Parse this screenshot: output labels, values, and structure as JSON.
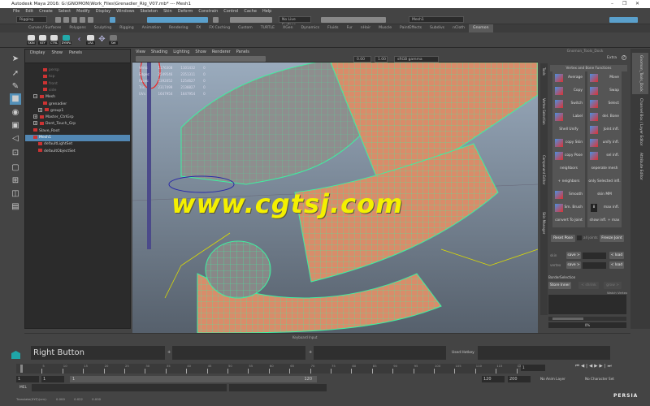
{
  "window": {
    "title": "Autodesk Maya 2016: G:\\GNOMON\\Work_Files\\Grenadier_Rig_V07.mb*  ---  Mesh1",
    "minimize": "–",
    "restore": "❐",
    "close": "✕"
  },
  "menus": [
    "File",
    "Edit",
    "Create",
    "Select",
    "Modify",
    "Display",
    "Windows",
    "Skeleton",
    "Skin",
    "Deform",
    "Constrain",
    "Control",
    "Cache",
    "Help"
  ],
  "status_line": {
    "menu_set": "Rigging",
    "live_surface": "No Live Surface",
    "object_name": "Mesh1"
  },
  "shelf_tabs": [
    "Curves / Surfaces",
    "Polygons",
    "Sculpting",
    "Rigging",
    "Animation",
    "Rendering",
    "FX",
    "FX Caching",
    "Custom",
    "TURTLE",
    "XGen",
    "Dynamics",
    "Fluids",
    "Fur",
    "nHair",
    "Muscle",
    "PaintEffects",
    "Subdivs",
    "nCloth",
    "Gnomon"
  ],
  "active_shelf_tab": "Gnomon",
  "shelf_buttons": [
    "SKIN",
    "KEY",
    "CTRL",
    "DYNPA",
    "",
    "LRA",
    "",
    "Set"
  ],
  "outliner": {
    "menu": [
      "Display",
      "Show",
      "Panels"
    ],
    "items": [
      {
        "label": "persp",
        "dim": true
      },
      {
        "label": "top",
        "dim": true
      },
      {
        "label": "front",
        "dim": true
      },
      {
        "label": "side",
        "dim": true
      },
      {
        "label": "Mesh"
      },
      {
        "label": "grenadier"
      },
      {
        "label": "group1"
      },
      {
        "label": "Master_CtrlGrp"
      },
      {
        "label": "Dont_Touch_Grp"
      },
      {
        "label": "Slave_Root"
      },
      {
        "label": "Mesh1",
        "selected": true
      },
      {
        "label": "defaultLightSet"
      },
      {
        "label": "defaultObjectSet"
      }
    ]
  },
  "viewport": {
    "menu": [
      "View",
      "Shading",
      "Lighting",
      "Show",
      "Renderer",
      "Panels"
    ],
    "exposure": "0.00",
    "gamma": "1.00",
    "color_space": "sRGB gamma",
    "hud": [
      {
        "label": "Verts:",
        "a": "1176308",
        "b": "1101432",
        "c": "0"
      },
      {
        "label": "Edges:",
        "a": "2549546",
        "b": "2351311",
        "c": "0"
      },
      {
        "label": "Faces:",
        "a": "1392052",
        "b": "1254627",
        "c": "0"
      },
      {
        "label": "Tris:",
        "a": "2317499",
        "b": "2138827",
        "c": "0"
      },
      {
        "label": "UVs:",
        "a": "1647954",
        "b": "1647954",
        "c": "0"
      }
    ],
    "watermark": "www.cgtsj.com"
  },
  "dock": {
    "title": "Gnomon_Tools_Dock",
    "extra": "Extra",
    "help": "?",
    "section": "Vertex and Bone Functions",
    "left_tabs": [
      "Tools",
      "Vertex Selection",
      "Component Editor",
      "Skin Manager"
    ],
    "left_buttons": [
      "Average",
      "Copy",
      "Switch",
      "Label",
      "Shell Unify",
      "copy Skin",
      "copy Pose",
      "neighbors",
      "+ neighbors",
      "Smooth",
      "Sm. Brush",
      "convert To Joint"
    ],
    "right_buttons": [
      "Move",
      "Swap",
      "Select",
      "del. Bone",
      "Joint infl.",
      "unify infl.",
      "sel infl.",
      "seperate mesh",
      "only Selected infl.",
      "skin MM",
      "max infl.",
      "show infl. + max"
    ],
    "max_infl_value": "8",
    "reset_pose": "Reset Pose",
    "all_joints": "all joints",
    "freeze_joint": "Freeze Joint",
    "skin_label": "skin",
    "vertex_label": "vertex",
    "save": "save >",
    "load": "< load",
    "border_section": "BorderSelection",
    "store_inner": "Store Inner",
    "shrink": "< shrink",
    "grow": "grow >",
    "watch_vertex": "Watch Vertex",
    "progress": "0%",
    "progress_value": 0
  },
  "side_tabs": [
    "Gnomon_Tools_Dock",
    "Channel Box / Layer Editor",
    "Attribute Editor"
  ],
  "hotkey": {
    "header": "Keyboard Input",
    "input": "Right Button",
    "plus": "+",
    "used_hotkey_label": "Used Hotkey"
  },
  "timeline": {
    "ticks": [
      "5",
      "10",
      "15",
      "20",
      "25",
      "30",
      "35",
      "40",
      "45",
      "50",
      "55",
      "60",
      "65",
      "70",
      "75",
      "80",
      "85",
      "90",
      "95",
      "100",
      "105",
      "110",
      "115",
      "120"
    ],
    "current_frame": "1",
    "start": "1",
    "playback_start": "1",
    "range_start": "1",
    "range_end": "120",
    "playback_end": "120",
    "end": "200",
    "anim_layer": "No Anim Layer",
    "character_set": "No Character Set"
  },
  "command_line": {
    "label": "MEL"
  },
  "help_line": {
    "label": "Translate(XYZ)(cm):",
    "x": "0.000",
    "y": "0.022",
    "z": "0.000"
  },
  "corner_logo": "PERSIA",
  "colors": {
    "accent": "#5390b8",
    "selection": "#5287b3",
    "wireframe": "#3ef0a0",
    "watermark": "#f4f000"
  }
}
